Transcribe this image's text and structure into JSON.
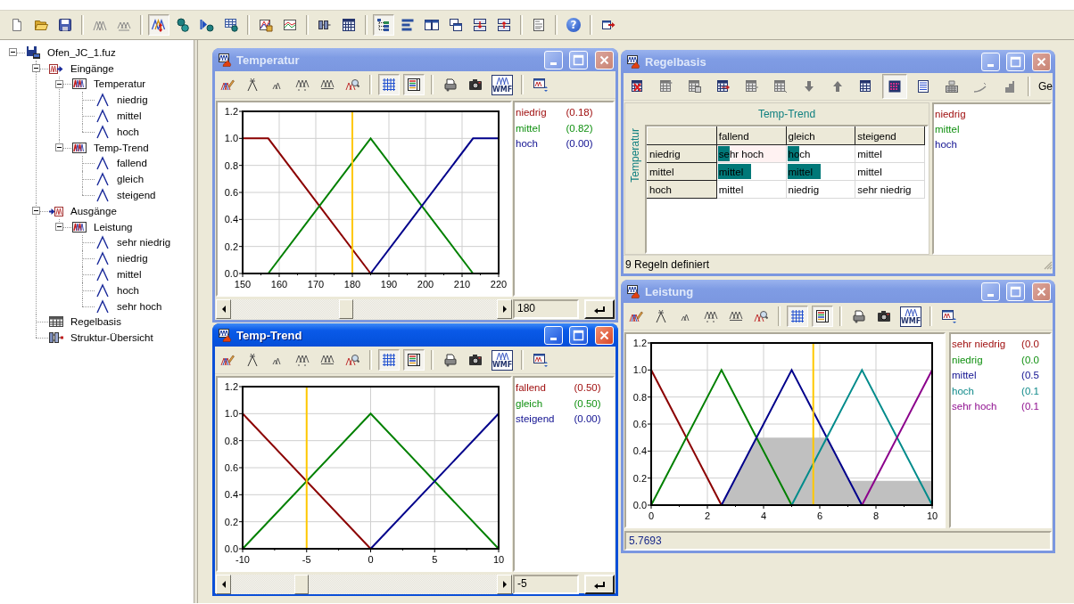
{
  "toolbar": [
    {
      "pressed": false
    },
    {
      "pressed": false
    },
    {
      "pressed": false
    },
    {
      "pressed": false
    },
    {
      "pressed": false
    },
    {
      "pressed": true
    },
    {
      "pressed": false
    },
    {
      "pressed": false
    },
    {
      "pressed": false
    },
    {
      "pressed": false
    },
    {
      "pressed": false
    },
    {
      "pressed": false
    },
    {
      "pressed": false
    },
    {
      "pressed": true
    },
    {
      "pressed": false
    },
    {
      "pressed": false
    },
    {
      "pressed": false
    },
    {
      "pressed": false
    },
    {
      "pressed": false
    },
    {
      "pressed": false
    },
    {
      "pressed": false,
      "glyph": "?"
    },
    {
      "pressed": false
    }
  ],
  "tree": [
    {
      "label": "Ofen_JC_1.fuz",
      "kind": "project",
      "expanded": true,
      "children": [
        {
          "label": "Eingänge",
          "kind": "inputs",
          "expanded": true,
          "children": [
            {
              "label": "Temperatur",
              "kind": "variable",
              "expanded": true,
              "children": [
                {
                  "label": "niedrig",
                  "kind": "term"
                },
                {
                  "label": "mittel",
                  "kind": "term"
                },
                {
                  "label": "hoch",
                  "kind": "term"
                }
              ]
            },
            {
              "label": "Temp-Trend",
              "kind": "variable",
              "expanded": true,
              "children": [
                {
                  "label": "fallend",
                  "kind": "term"
                },
                {
                  "label": "gleich",
                  "kind": "term"
                },
                {
                  "label": "steigend",
                  "kind": "term"
                }
              ]
            }
          ]
        },
        {
          "label": "Ausgänge",
          "kind": "outputs",
          "expanded": true,
          "children": [
            {
              "label": "Leistung",
              "kind": "variable",
              "expanded": true,
              "children": [
                {
                  "label": "sehr niedrig",
                  "kind": "term"
                },
                {
                  "label": "niedrig",
                  "kind": "term"
                },
                {
                  "label": "mittel",
                  "kind": "term"
                },
                {
                  "label": "hoch",
                  "kind": "term"
                },
                {
                  "label": "sehr hoch",
                  "kind": "term"
                }
              ]
            }
          ]
        },
        {
          "label": "Regelbasis",
          "kind": "rules"
        },
        {
          "label": "Struktur-Übersicht",
          "kind": "overview"
        }
      ]
    }
  ],
  "windows": [
    {
      "kind": "input_chart",
      "title": "Temperatur",
      "active": false,
      "toolbar": [
        {
          "pressed": false
        },
        {
          "pressed": false
        },
        {
          "pressed": false
        },
        {
          "pressed": false
        },
        {
          "pressed": false
        },
        {
          "pressed": false
        },
        {
          "pressed": true
        },
        {
          "pressed": true
        },
        {
          "pressed": false
        },
        {
          "pressed": false
        },
        {
          "pressed": false,
          "glyph": "WMF"
        },
        {
          "pressed": false
        }
      ],
      "chart_data": {
        "type": "line",
        "grid": true,
        "x": [
          150,
          157,
          185,
          213,
          220
        ],
        "series": [
          {
            "name": "niedrig",
            "color": "#8b0000",
            "values": [
              1,
              1,
              0,
              null,
              null
            ]
          },
          {
            "name": "mittel",
            "color": "#008000",
            "values": [
              null,
              0,
              1,
              0,
              null
            ]
          },
          {
            "name": "hoch",
            "color": "#00008b",
            "values": [
              null,
              null,
              0,
              1,
              1
            ]
          }
        ],
        "xlim": [
          150,
          220
        ],
        "ylim": [
          0,
          1.2
        ],
        "xticks": [
          150,
          160,
          170,
          180,
          190,
          200,
          210,
          220
        ],
        "yticks": [
          {
            "value": 0,
            "label": "0.0"
          },
          {
            "value": 0.2,
            "label": "0.2"
          },
          {
            "value": 0.4,
            "label": "0.4"
          },
          {
            "value": 0.6,
            "label": "0.6"
          },
          {
            "value": 0.8,
            "label": "0.8"
          },
          {
            "value": 1,
            "label": "1.0"
          },
          {
            "value": 1.2,
            "label": "1.2"
          }
        ],
        "ref_lines": [
          {
            "axis": "x",
            "value": 180
          }
        ]
      },
      "legend": [
        {
          "value": "(0.18)",
          "color": "#a01010"
        },
        {
          "value": "(0.82)",
          "color": "#109010"
        },
        {
          "value": "(0.00)",
          "color": "#101090"
        }
      ],
      "slider": {
        "level": 0.43
      },
      "value": "180"
    },
    {
      "kind": "rule_base",
      "title": "Regelbasis",
      "active": false,
      "toolbar": [
        {
          "pressed": false
        },
        {
          "pressed": false
        },
        {
          "pressed": false
        },
        {
          "pressed": false
        },
        {
          "pressed": false
        },
        {
          "pressed": false
        },
        {
          "pressed": false
        },
        {
          "pressed": false
        },
        {
          "pressed": false
        },
        {
          "pressed": true
        },
        {
          "pressed": false
        },
        {
          "pressed": false
        },
        {
          "pressed": false
        },
        {
          "pressed": false
        }
      ],
      "toolbar_text": "Ge",
      "column_variable": "Temp-Trend",
      "row_variable": "Temperatur",
      "columns": [
        "fallend",
        "gleich",
        "steigend"
      ],
      "rows": [
        {
          "label": "niedrig",
          "cells": [
            {
              "text": "sehr hoch",
              "level": 0.18,
              "selected": true
            },
            {
              "text": "hoch",
              "level": 0.18,
              "selected": false
            },
            {
              "text": "mittel",
              "selected": false
            }
          ]
        },
        {
          "label": "mittel",
          "cells": [
            {
              "text": "mittel",
              "level": 0.5,
              "selected": false
            },
            {
              "text": "mittel",
              "level": 0.5,
              "selected": false
            },
            {
              "text": "mittel",
              "selected": false
            }
          ]
        },
        {
          "label": "hoch",
          "cells": [
            {
              "text": "mittel",
              "selected": false
            },
            {
              "text": "niedrig",
              "selected": false
            },
            {
              "text": "sehr niedrig",
              "selected": false
            }
          ]
        }
      ],
      "legend": [
        {
          "name": "niedrig",
          "color": "#a01010"
        },
        {
          "name": "mittel",
          "color": "#109010"
        },
        {
          "name": "hoch",
          "color": "#101090"
        }
      ],
      "status": "9 Regeln definiert"
    },
    {
      "kind": "output_chart",
      "title": "Leistung",
      "active": false,
      "toolbar": [
        {
          "pressed": false
        },
        {
          "pressed": false
        },
        {
          "pressed": false
        },
        {
          "pressed": false
        },
        {
          "pressed": false
        },
        {
          "pressed": false
        },
        {
          "pressed": true
        },
        {
          "pressed": true
        },
        {
          "pressed": false
        },
        {
          "pressed": false
        },
        {
          "pressed": false,
          "glyph": "WMF"
        },
        {
          "pressed": false
        }
      ],
      "chart_data": {
        "type": "line",
        "grid": true,
        "x": [
          0,
          2.5,
          3.75,
          5,
          6.25,
          7.05,
          7.5,
          10
        ],
        "series": [
          {
            "type": "area",
            "color": "#c0c0c0",
            "values": [
              null,
              0,
              0.5,
              0.5,
              0.5,
              0.18,
              0.18,
              0.18
            ]
          },
          {
            "name": "sehr niedrig",
            "color": "#8b0000",
            "values": [
              1,
              0,
              null,
              null,
              null,
              null,
              null,
              null
            ]
          },
          {
            "name": "niedrig",
            "color": "#008000",
            "values": [
              0,
              1,
              0.5,
              0,
              null,
              null,
              null,
              null
            ]
          },
          {
            "name": "mittel",
            "color": "#00008b",
            "values": [
              null,
              0,
              0.5,
              1,
              0.5,
              0.18,
              0,
              null
            ]
          },
          {
            "name": "hoch",
            "color": "#008b8b",
            "values": [
              null,
              null,
              null,
              0,
              0.5,
              0.82,
              1,
              0
            ]
          },
          {
            "name": "sehr hoch",
            "color": "#8b008b",
            "values": [
              null,
              null,
              null,
              null,
              null,
              null,
              0,
              1
            ]
          }
        ],
        "xlim": [
          0,
          10
        ],
        "ylim": [
          0,
          1.2
        ],
        "xticks": [
          0,
          2,
          4,
          6,
          8,
          10
        ],
        "yticks": [
          {
            "value": 0,
            "label": "0.0"
          },
          {
            "value": 0.2,
            "label": "0.2"
          },
          {
            "value": 0.4,
            "label": "0.4"
          },
          {
            "value": 0.6,
            "label": "0.6"
          },
          {
            "value": 0.8,
            "label": "0.8"
          },
          {
            "value": 1,
            "label": "1.0"
          },
          {
            "value": 1.2,
            "label": "1.2"
          }
        ],
        "ref_lines": [
          {
            "axis": "x",
            "value": 5.7693
          }
        ]
      },
      "legend": [
        {
          "value": "(0.0",
          "color": "#a01010"
        },
        {
          "value": "(0.0",
          "color": "#109010"
        },
        {
          "value": "(0.5",
          "color": "#101090"
        },
        {
          "value": "(0.1",
          "color": "#108a8a"
        },
        {
          "value": "(0.1",
          "color": "#901090"
        }
      ],
      "status": "5.7693"
    },
    {
      "kind": "input_chart",
      "title": "Temp-Trend",
      "active": true,
      "toolbar": [
        {
          "pressed": false
        },
        {
          "pressed": false
        },
        {
          "pressed": false
        },
        {
          "pressed": false
        },
        {
          "pressed": false
        },
        {
          "pressed": false
        },
        {
          "pressed": true
        },
        {
          "pressed": true
        },
        {
          "pressed": false
        },
        {
          "pressed": false
        },
        {
          "pressed": false,
          "glyph": "WMF"
        },
        {
          "pressed": false
        }
      ],
      "chart_data": {
        "type": "line",
        "grid": true,
        "x": [
          -10,
          0,
          10
        ],
        "series": [
          {
            "name": "fallend",
            "color": "#8b0000",
            "values": [
              1,
              0,
              null
            ]
          },
          {
            "name": "gleich",
            "color": "#008000",
            "values": [
              0,
              1,
              0
            ]
          },
          {
            "name": "steigend",
            "color": "#00008b",
            "values": [
              null,
              0,
              1
            ]
          }
        ],
        "xlim": [
          -10,
          10
        ],
        "ylim": [
          0,
          1.2
        ],
        "xticks": [
          -10,
          -5,
          0,
          5,
          10
        ],
        "yticks": [
          {
            "value": 0,
            "label": "0.0"
          },
          {
            "value": 0.2,
            "label": "0.2"
          },
          {
            "value": 0.4,
            "label": "0.4"
          },
          {
            "value": 0.6,
            "label": "0.6"
          },
          {
            "value": 0.8,
            "label": "0.8"
          },
          {
            "value": 1,
            "label": "1.0"
          },
          {
            "value": 1.2,
            "label": "1.2"
          }
        ],
        "ref_lines": [
          {
            "axis": "x",
            "value": -5
          }
        ]
      },
      "legend": [
        {
          "value": "(0.50)",
          "color": "#a01010"
        },
        {
          "value": "(0.50)",
          "color": "#109010"
        },
        {
          "value": "(0.00)",
          "color": "#101090"
        }
      ],
      "slider": {
        "level": 0.25
      },
      "value": "-5"
    }
  ]
}
